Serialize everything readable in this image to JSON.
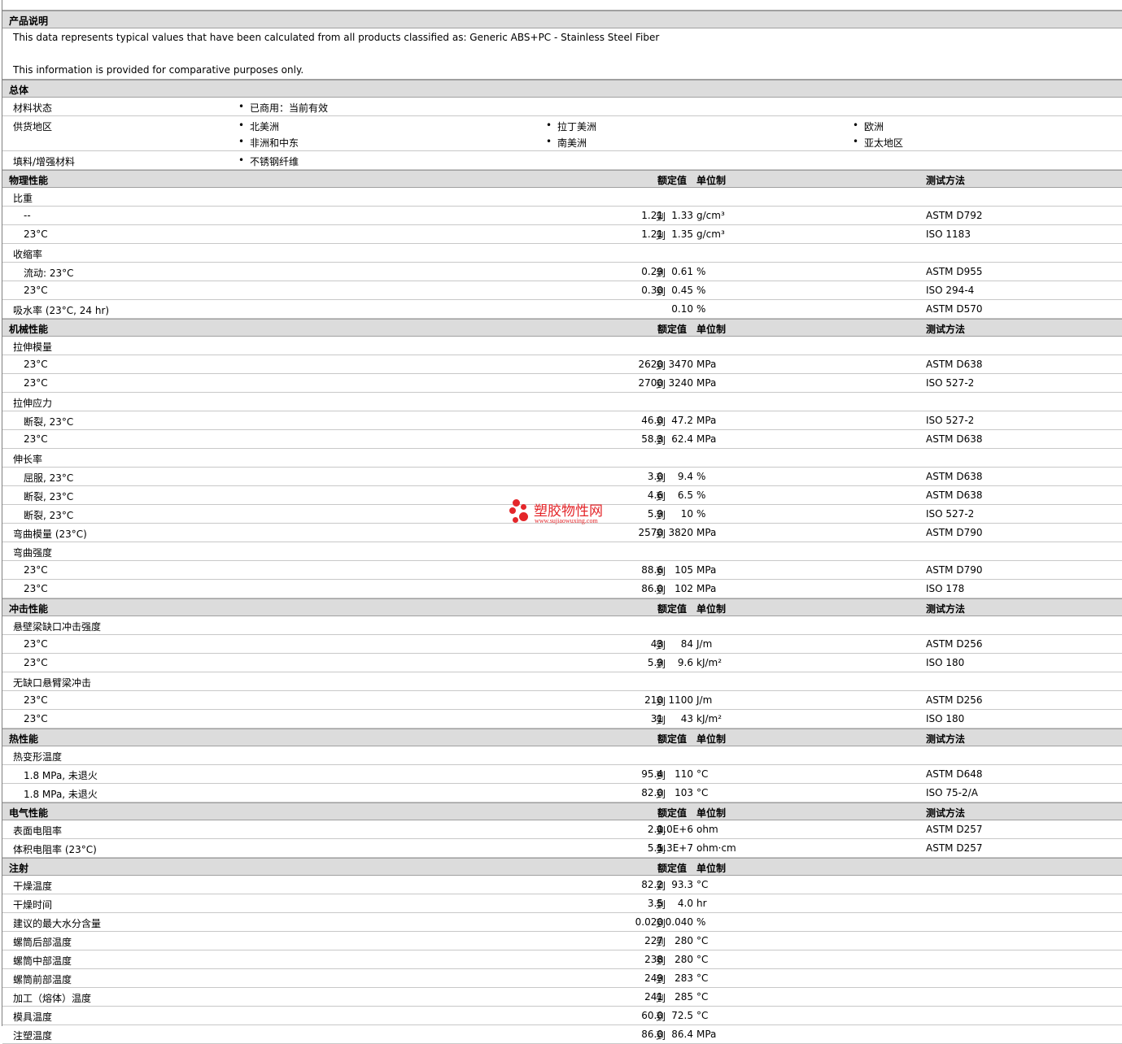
{
  "sections": {
    "desc_title": "产品说明",
    "desc_line1": "This data represents typical values that have been calculated from all products classified as: Generic ABS+PC - Stainless Steel Fiber",
    "desc_line2": "This information is provided for comparative purposes only.",
    "general": "总体",
    "physical": "物理性能",
    "mechanical": "机械性能",
    "impact": "冲击性能",
    "thermal": "热性能",
    "electrical": "电气性能",
    "injection": "注射"
  },
  "cols": {
    "nominal": "额定值",
    "unit": "单位制",
    "method": "测试方法"
  },
  "general": {
    "status_label": "材料状态",
    "status_value": "已商用：当前有效",
    "supply_label": "供货地区",
    "regions": [
      "北美洲",
      "拉丁美洲",
      "欧洲",
      "非洲和中东",
      "南美洲",
      "亚太地区"
    ],
    "filler_label": "填料/增强材料",
    "filler_value": "不锈钢纤维"
  },
  "rows": [
    {
      "label": "比重",
      "group": true
    },
    {
      "label": "--",
      "min": "1.21",
      "sep": "到",
      "max": "1.33",
      "unit": "g/cm³",
      "method": "ASTM D792"
    },
    {
      "label": "23°C",
      "min": "1.21",
      "sep": "到",
      "max": "1.35",
      "unit": "g/cm³",
      "method": "ISO 1183"
    },
    {
      "label": "收缩率",
      "group": true
    },
    {
      "label": "流动: 23°C",
      "min": "0.29",
      "sep": "到",
      "max": "0.61",
      "unit": "%",
      "method": "ASTM D955"
    },
    {
      "label": "23°C",
      "min": "0.30",
      "sep": "到",
      "max": "0.45",
      "unit": "%",
      "method": "ISO 294-4"
    },
    {
      "label": "吸水率 (23°C, 24 hr)",
      "top": true,
      "min": "",
      "sep": "",
      "max": "0.10",
      "unit": "%",
      "method": "ASTM D570"
    },
    {
      "label": "拉伸模量",
      "group": true
    },
    {
      "label": "23°C",
      "min": "2620",
      "sep": "到",
      "max": "3470",
      "unit": "MPa",
      "method": "ASTM D638"
    },
    {
      "label": "23°C",
      "min": "2700",
      "sep": "到",
      "max": "3240",
      "unit": "MPa",
      "method": "ISO 527-2"
    },
    {
      "label": "拉伸应力",
      "group": true
    },
    {
      "label": "断裂, 23°C",
      "min": "46.0",
      "sep": "到",
      "max": "47.2",
      "unit": "MPa",
      "method": "ISO 527-2"
    },
    {
      "label": "23°C",
      "min": "58.3",
      "sep": "到",
      "max": "62.4",
      "unit": "MPa",
      "method": "ASTM D638"
    },
    {
      "label": "伸长率",
      "group": true
    },
    {
      "label": "屈服, 23°C",
      "min": "3.0",
      "sep": "到",
      "max": "9.4",
      "unit": "%",
      "method": "ASTM D638"
    },
    {
      "label": "断裂, 23°C",
      "min": "4.6",
      "sep": "到",
      "max": "6.5",
      "unit": "%",
      "method": "ASTM D638"
    },
    {
      "label": "断裂, 23°C",
      "min": "5.9",
      "sep": "到",
      "max": "10",
      "unit": "%",
      "method": "ISO 527-2"
    },
    {
      "label": "弯曲模量 (23°C)",
      "top": true,
      "min": "2570",
      "sep": "到",
      "max": "3820",
      "unit": "MPa",
      "method": "ASTM D790"
    },
    {
      "label": "弯曲强度",
      "group": true
    },
    {
      "label": "23°C",
      "min": "88.6",
      "sep": "到",
      "max": "105",
      "unit": "MPa",
      "method": "ASTM D790"
    },
    {
      "label": "23°C",
      "min": "86.0",
      "sep": "到",
      "max": "102",
      "unit": "MPa",
      "method": "ISO 178"
    },
    {
      "label": "悬壁梁缺口冲击强度",
      "group": true
    },
    {
      "label": "23°C",
      "min": "43",
      "sep": "到",
      "max": "84",
      "unit": "J/m",
      "method": "ASTM D256"
    },
    {
      "label": "23°C",
      "min": "5.9",
      "sep": "到",
      "max": "9.6",
      "unit": "kJ/m²",
      "method": "ISO 180"
    },
    {
      "label": "无缺口悬臂梁冲击",
      "group": true
    },
    {
      "label": "23°C",
      "min": "210",
      "sep": "到",
      "max": "1100",
      "unit": "J/m",
      "method": "ASTM D256"
    },
    {
      "label": "23°C",
      "min": "31",
      "sep": "到",
      "max": "43",
      "unit": "kJ/m²",
      "method": "ISO 180"
    },
    {
      "label": "热变形温度",
      "group": true
    },
    {
      "label": "1.8 MPa, 未退火",
      "min": "95.4",
      "sep": "到",
      "max": "110",
      "unit": "°C",
      "method": "ASTM D648"
    },
    {
      "label": "1.8 MPa, 未退火",
      "min": "82.0",
      "sep": "到",
      "max": "103",
      "unit": "°C",
      "method": "ISO 75-2/A"
    },
    {
      "label": "表面电阻率",
      "top": true,
      "min": "2.0",
      "sep": "到",
      "max": "1.0E+6",
      "unit": "ohm",
      "method": "ASTM D257"
    },
    {
      "label": "体积电阻率 (23°C)",
      "top": true,
      "min": "5.5",
      "sep": "到",
      "max": "1.3E+7",
      "unit": "ohm·cm",
      "method": "ASTM D257"
    },
    {
      "label": "干燥温度",
      "top": true,
      "min": "82.2",
      "sep": "到",
      "max": "93.3",
      "unit": "°C",
      "method": ""
    },
    {
      "label": "干燥时间",
      "top": true,
      "min": "3.5",
      "sep": "到",
      "max": "4.0",
      "unit": "hr",
      "method": ""
    },
    {
      "label": "建议的最大水分含量",
      "top": true,
      "min": "0.020",
      "sep": "到",
      "max": "0.040",
      "unit": "%",
      "method": ""
    },
    {
      "label": "螺筒后部温度",
      "top": true,
      "min": "227",
      "sep": "到",
      "max": "280",
      "unit": "°C",
      "method": ""
    },
    {
      "label": "螺筒中部温度",
      "top": true,
      "min": "238",
      "sep": "到",
      "max": "280",
      "unit": "°C",
      "method": ""
    },
    {
      "label": "螺筒前部温度",
      "top": true,
      "min": "249",
      "sep": "到",
      "max": "283",
      "unit": "°C",
      "method": ""
    },
    {
      "label": "加工（熔体）温度",
      "top": true,
      "min": "241",
      "sep": "到",
      "max": "285",
      "unit": "°C",
      "method": ""
    },
    {
      "label": "模具温度",
      "top": true,
      "min": "60.0",
      "sep": "到",
      "max": "72.5",
      "unit": "°C",
      "method": ""
    },
    {
      "label": "注塑温度",
      "top": true,
      "min": "86.0",
      "sep": "到",
      "max": "86.4",
      "unit": "MPa",
      "method": ""
    }
  ],
  "watermark": {
    "title": "塑胶物性网",
    "url": "www.sujiaowuxing.com"
  }
}
